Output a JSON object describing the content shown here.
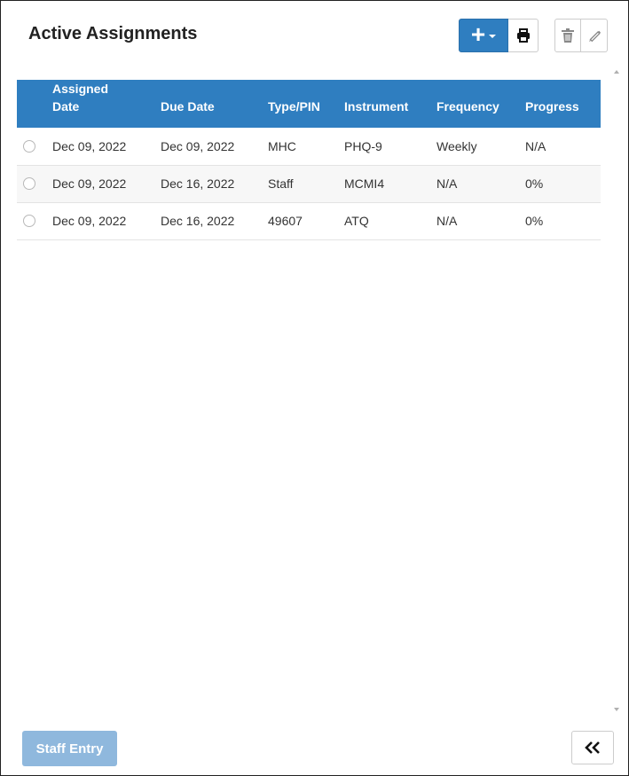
{
  "panel": {
    "title": "Active Assignments"
  },
  "toolbar": {
    "add_icon": "plus-icon",
    "dropdown_icon": "caret-down-icon",
    "print_icon": "printer-icon",
    "delete_icon": "trash-icon",
    "edit_icon": "pencil-icon",
    "accent_color": "#2f7ec0"
  },
  "table": {
    "columns": [
      "",
      "Assigned Date",
      "Due Date",
      "Type/PIN",
      "Instrument",
      "Frequency",
      "Progress"
    ],
    "column_lines": {
      "assigned_date": [
        "Assigned",
        "Date"
      ]
    },
    "rows": [
      {
        "assigned_date": "Dec 09, 2022",
        "due_date": "Dec 09, 2022",
        "type_pin": "MHC",
        "instrument": "PHQ-9",
        "frequency": "Weekly",
        "progress": "N/A"
      },
      {
        "assigned_date": "Dec 09, 2022",
        "due_date": "Dec 16, 2022",
        "type_pin": "Staff",
        "instrument": "MCMI4",
        "frequency": "N/A",
        "progress": "0%"
      },
      {
        "assigned_date": "Dec 09, 2022",
        "due_date": "Dec 16, 2022",
        "type_pin": "49607",
        "instrument": "ATQ",
        "frequency": "N/A",
        "progress": "0%"
      }
    ]
  },
  "footer": {
    "staff_entry_label": "Staff Entry",
    "collapse_icon": "double-chevron-left-icon"
  }
}
